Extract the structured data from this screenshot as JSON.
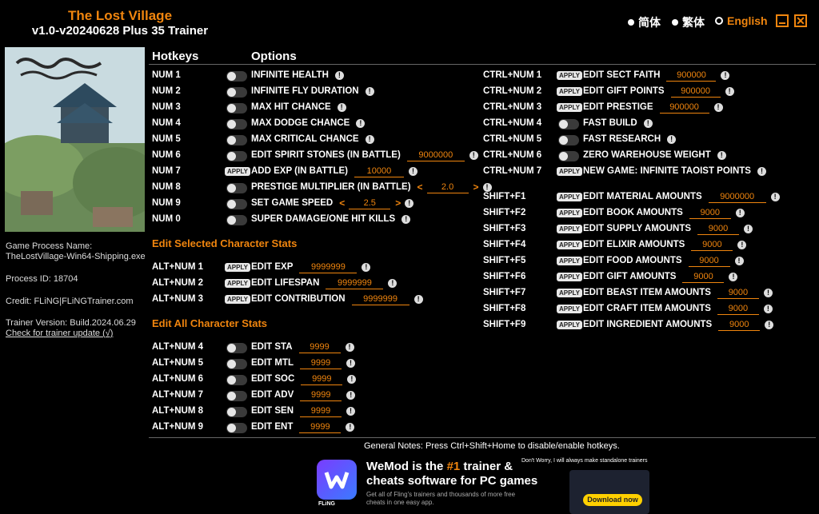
{
  "header": {
    "game_title": "The Lost Village",
    "version": "v1.0-v20240628 Plus 35 Trainer",
    "languages": [
      {
        "label": "简体",
        "active": false
      },
      {
        "label": "繁体",
        "active": false
      },
      {
        "label": "English",
        "active": true
      }
    ]
  },
  "sidebar": {
    "process_name_label": "Game Process Name:",
    "process_name": "TheLostVillage-Win64-Shipping.exe",
    "process_id": "Process ID: 18704",
    "credit": "Credit: FLiNG|FLiNGTrainer.com",
    "trainer_version": "Trainer Version: Build.2024.06.29",
    "check_update": "Check for trainer update (√)"
  },
  "table_headers": {
    "hotkeys": "Hotkeys",
    "options": "Options"
  },
  "main_options": [
    {
      "hotkey": "NUM 1",
      "label": "INFINITE HEALTH",
      "control": "toggle"
    },
    {
      "hotkey": "NUM 2",
      "label": "INFINITE FLY DURATION",
      "control": "toggle"
    },
    {
      "hotkey": "NUM 3",
      "label": "MAX HIT CHANCE",
      "control": "toggle"
    },
    {
      "hotkey": "NUM 4",
      "label": "MAX DODGE CHANCE",
      "control": "toggle"
    },
    {
      "hotkey": "NUM 5",
      "label": "MAX CRITICAL CHANCE",
      "control": "toggle"
    },
    {
      "hotkey": "NUM 6",
      "label": "EDIT SPIRIT STONES (IN BATTLE)",
      "control": "toggle",
      "value": "9000000"
    },
    {
      "hotkey": "NUM 7",
      "label": "ADD EXP (IN BATTLE)",
      "control": "apply",
      "value": "10000"
    },
    {
      "hotkey": "NUM 8",
      "label": "PRESTIGE MULTIPLIER (IN BATTLE)",
      "control": "toggle",
      "value": "2.0",
      "slider": true
    },
    {
      "hotkey": "NUM 9",
      "label": "SET GAME SPEED",
      "control": "toggle",
      "value": "2.5",
      "slider": true
    },
    {
      "hotkey": "NUM 0",
      "label": "SUPER DAMAGE/ONE HIT KILLS",
      "control": "toggle"
    }
  ],
  "selected_section": {
    "title": "Edit Selected Character Stats",
    "options": [
      {
        "hotkey": "ALT+NUM 1",
        "label": "EDIT EXP",
        "control": "apply",
        "value": "9999999"
      },
      {
        "hotkey": "ALT+NUM 2",
        "label": "EDIT LIFESPAN",
        "control": "apply",
        "value": "9999999"
      },
      {
        "hotkey": "ALT+NUM 3",
        "label": "EDIT CONTRIBUTION",
        "control": "apply",
        "value": "9999999"
      }
    ]
  },
  "all_section": {
    "title": "Edit All Character Stats",
    "options": [
      {
        "hotkey": "ALT+NUM 4",
        "label": "EDIT STA",
        "control": "toggle",
        "value": "9999"
      },
      {
        "hotkey": "ALT+NUM 5",
        "label": "EDIT MTL",
        "control": "toggle",
        "value": "9999"
      },
      {
        "hotkey": "ALT+NUM 6",
        "label": "EDIT SOC",
        "control": "toggle",
        "value": "9999"
      },
      {
        "hotkey": "ALT+NUM 7",
        "label": "EDIT ADV",
        "control": "toggle",
        "value": "9999"
      },
      {
        "hotkey": "ALT+NUM 8",
        "label": "EDIT SEN",
        "control": "toggle",
        "value": "9999"
      },
      {
        "hotkey": "ALT+NUM 9",
        "label": "EDIT ENT",
        "control": "toggle",
        "value": "9999"
      }
    ]
  },
  "ctrl_options": [
    {
      "hotkey": "CTRL+NUM 1",
      "label": "EDIT SECT FAITH",
      "control": "apply",
      "value": "900000"
    },
    {
      "hotkey": "CTRL+NUM 2",
      "label": "EDIT GIFT POINTS",
      "control": "apply",
      "value": "900000"
    },
    {
      "hotkey": "CTRL+NUM 3",
      "label": "EDIT PRESTIGE",
      "control": "apply",
      "value": "900000"
    },
    {
      "hotkey": "CTRL+NUM 4",
      "label": "FAST BUILD",
      "control": "toggle"
    },
    {
      "hotkey": "CTRL+NUM 5",
      "label": "FAST RESEARCH",
      "control": "toggle"
    },
    {
      "hotkey": "CTRL+NUM 6",
      "label": "ZERO WAREHOUSE WEIGHT",
      "control": "toggle"
    },
    {
      "hotkey": "CTRL+NUM 7",
      "label": "NEW GAME: INFINITE TAOIST POINTS",
      "control": "apply"
    }
  ],
  "shift_options": [
    {
      "hotkey": "SHIFT+F1",
      "label": "EDIT MATERIAL AMOUNTS",
      "control": "apply",
      "value": "9000000"
    },
    {
      "hotkey": "SHIFT+F2",
      "label": "EDIT BOOK AMOUNTS",
      "control": "apply",
      "value": "9000"
    },
    {
      "hotkey": "SHIFT+F3",
      "label": "EDIT SUPPLY AMOUNTS",
      "control": "apply",
      "value": "9000"
    },
    {
      "hotkey": "SHIFT+F4",
      "label": "EDIT ELIXIR AMOUNTS",
      "control": "apply",
      "value": "9000"
    },
    {
      "hotkey": "SHIFT+F5",
      "label": "EDIT FOOD AMOUNTS",
      "control": "apply",
      "value": "9000"
    },
    {
      "hotkey": "SHIFT+F6",
      "label": "EDIT GIFT AMOUNTS",
      "control": "apply",
      "value": "9000"
    },
    {
      "hotkey": "SHIFT+F7",
      "label": "EDIT BEAST ITEM AMOUNTS",
      "control": "apply",
      "value": "9000"
    },
    {
      "hotkey": "SHIFT+F8",
      "label": "EDIT CRAFT ITEM AMOUNTS",
      "control": "apply",
      "value": "9000"
    },
    {
      "hotkey": "SHIFT+F9",
      "label": "EDIT INGREDIENT AMOUNTS",
      "control": "apply",
      "value": "9000"
    }
  ],
  "apply_label": "APPLY",
  "info_glyph": "!",
  "arrow_left": "<",
  "arrow_right": ">",
  "notes": "General Notes: Press Ctrl+Shift+Home to disable/enable hotkeys.",
  "ad": {
    "title_pre": "WeMod is the ",
    "title_hl": "#1",
    "title_post": " trainer &",
    "title_line2": "cheats software for PC games",
    "subtitle": "Get all of Fling's trainers and thousands of more free cheats in one easy app.",
    "note": "Don't Worry, I will always make standalone trainers",
    "download": "Download now",
    "logo_text": "FLiNG"
  },
  "colors": {
    "accent": "#f0850e",
    "background": "#000000"
  }
}
